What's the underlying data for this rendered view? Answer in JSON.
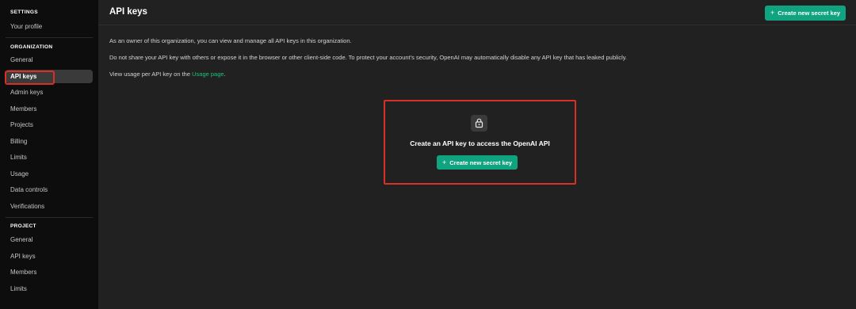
{
  "sidebar": {
    "settings_title": "SETTINGS",
    "your_profile": "Your profile",
    "organization_title": "ORGANIZATION",
    "org_items": [
      "General",
      "API keys",
      "Admin keys",
      "Members",
      "Projects",
      "Billing",
      "Limits",
      "Usage",
      "Data controls",
      "Verifications"
    ],
    "project_title": "PROJECT",
    "project_items": [
      "General",
      "API keys",
      "Members",
      "Limits"
    ]
  },
  "header": {
    "title": "API keys",
    "create_button": "Create new secret key"
  },
  "content": {
    "para1": "As an owner of this organization, you can view and manage all API keys in this organization.",
    "para2": "Do not share your API key with others or expose it in the browser or other client-side code. To protect your account's security, OpenAI may automatically disable any API key that has leaked publicly.",
    "para3_prefix": "View usage per API key on the ",
    "para3_link": "Usage page",
    "para3_suffix": "."
  },
  "empty_state": {
    "icon": "lock-icon",
    "title": "Create an API key to access the OpenAI API",
    "button": "Create new secret key"
  },
  "colors": {
    "accent": "#10a37f",
    "highlight": "#d93025",
    "link": "#19c37d"
  }
}
